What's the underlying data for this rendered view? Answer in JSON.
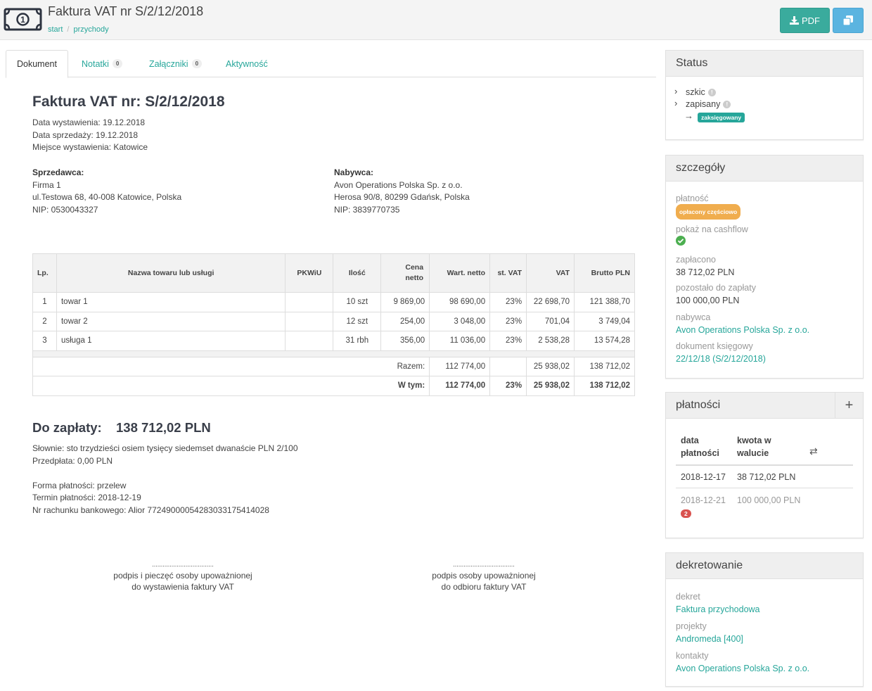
{
  "header": {
    "title": "Faktura VAT nr S/2/12/2018",
    "breadcrumb": [
      "start",
      "przychody"
    ],
    "pdf_label": "PDF"
  },
  "tabs": [
    {
      "label": "Dokument"
    },
    {
      "label": "Notatki",
      "count": "0"
    },
    {
      "label": "Załączniki",
      "count": "0"
    },
    {
      "label": "Aktywność"
    }
  ],
  "invoice": {
    "title": "Faktura VAT nr: S/2/12/2018",
    "issue_date": "Data wystawienia: 19.12.2018",
    "sale_date": "Data sprzedaży: 19.12.2018",
    "place": "Miejsce wystawienia: Katowice",
    "seller": {
      "label": "Sprzedawca:",
      "name": "Firma 1",
      "address": "ul.Testowa 68, 40-008 Katowice, Polska",
      "nip": "NIP: 0530043327"
    },
    "buyer": {
      "label": "Nabywca:",
      "name": "Avon Operations Polska Sp. z o.o.",
      "address": "Herosa 90/8, 80299 Gdańsk, Polska",
      "nip": "NIP: 3839770735"
    },
    "columns": [
      "Lp.",
      "Nazwa towaru lub usługi",
      "PKWiU",
      "Ilość",
      "Cena netto",
      "Wart. netto",
      "st. VAT",
      "VAT",
      "Brutto PLN"
    ],
    "rows": [
      [
        "1",
        "towar 1",
        "",
        "10 szt",
        "9 869,00",
        "98 690,00",
        "23%",
        "22 698,70",
        "121 388,70"
      ],
      [
        "2",
        "towar 2",
        "",
        "12 szt",
        "254,00",
        "3 048,00",
        "23%",
        "701,04",
        "3 749,04"
      ],
      [
        "3",
        "usługa 1",
        "",
        "31 rbh",
        "356,00",
        "11 036,00",
        "23%",
        "2 538,28",
        "13 574,28"
      ]
    ],
    "total_row": {
      "label": "Razem:",
      "netto": "112 774,00",
      "vat_rate": "",
      "vat": "25 938,02",
      "brutto": "138 712,02"
    },
    "of_which_row": {
      "label": "W tym:",
      "netto": "112 774,00",
      "vat_rate": "23%",
      "vat": "25 938,02",
      "brutto": "138 712,02"
    },
    "to_pay_label": "Do zapłaty:",
    "to_pay_amount": "138 712,02 PLN",
    "in_words": "Słownie:  sto trzydzieści osiem tysięcy siedemset dwanaście PLN 2/100",
    "prepayment": "Przedpłata:  0,00 PLN",
    "payment_form": "Forma płatności: przelew",
    "payment_term": "Termin płatności: 2018-12-19",
    "bank_account": "Nr rachunku bankowego: Alior 77249000054283033175414028",
    "sign_dots": "...................................",
    "sign_left_1": "podpis i pieczęć osoby upoważnionej",
    "sign_left_2": "do wystawienia faktury VAT",
    "sign_right_1": "podpis osoby upoważnionej",
    "sign_right_2": "do odbioru faktury VAT"
  },
  "status_panel": {
    "title": "Status",
    "steps": [
      {
        "label": "szkic"
      },
      {
        "label": "zapisany"
      },
      {
        "label": "zaksięgowany",
        "current": true
      }
    ],
    "info_glyph": "!"
  },
  "details_panel": {
    "title": "szczegóły",
    "payment_label": "płatność",
    "payment_status": "opłacony częściowo",
    "cashflow_label": "pokaż na cashflow",
    "paid_label": "zapłacono",
    "paid_value": "38 712,02 PLN",
    "remaining_label": "pozostało do zapłaty",
    "remaining_value": "100 000,00 PLN",
    "buyer_label": "nabywca",
    "buyer_value": "Avon Operations Polska Sp. z o.o.",
    "doc_label": "dokument księgowy",
    "doc_value": "22/12/18 (S/2/12/2018)"
  },
  "payments_panel": {
    "title": "płatności",
    "col_date_1": "data",
    "col_date_2": "płatności",
    "col_amount_1": "kwota w",
    "col_amount_2": "walucie",
    "rows": [
      {
        "date": "2018-12-17",
        "amount": "38 712,02 PLN"
      },
      {
        "date": "2018-12-21",
        "amount": "100 000,00 PLN",
        "badge": "2"
      }
    ]
  },
  "booking_panel": {
    "title": "dekretowanie",
    "decree_label": "dekret",
    "decree_value": "Faktura przychodowa",
    "projects_label": "projekty",
    "projects_value": "Andromeda [400]",
    "contacts_label": "kontakty",
    "contacts_value": "Avon Operations Polska Sp. z o.o."
  },
  "colors": {
    "accent": "#26a69a",
    "pdf_button": "#3aab9d",
    "copy_button": "#5bb4e0",
    "badge_orange": "#f0ad4e",
    "badge_red": "#d9534f"
  }
}
